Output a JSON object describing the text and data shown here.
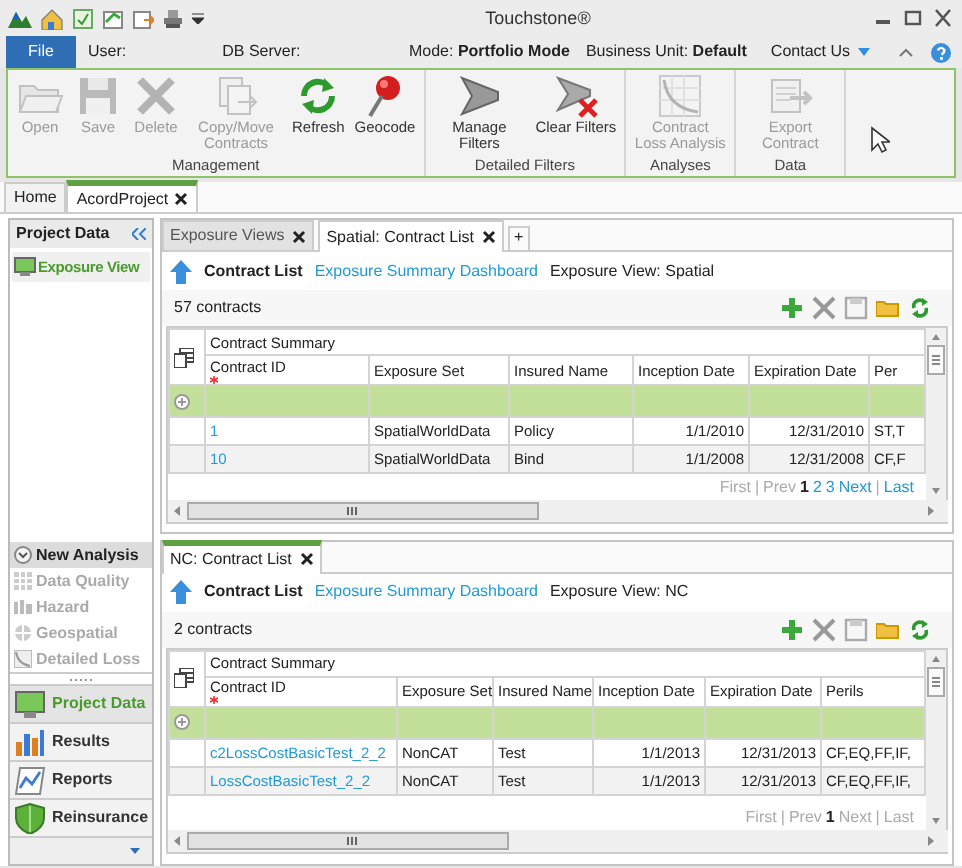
{
  "title_bar": {
    "title": "Touchstone®"
  },
  "menu_bar": {
    "file": "File",
    "user": "User:",
    "db_server": "DB Server:",
    "mode": "Mode: **Portfolio Mode**",
    "business_unit": "Business Unit: **Default**",
    "contact": "Contact Us"
  },
  "ribbon": {
    "groups": [
      {
        "label": "Management",
        "buttons": [
          {
            "label": "Open",
            "disabled": true
          },
          {
            "label": "Save",
            "disabled": true
          },
          {
            "label": "Delete",
            "disabled": true
          },
          {
            "label": "Copy/Move Contracts",
            "disabled": true
          },
          {
            "label": "Refresh",
            "disabled": false
          },
          {
            "label": "Geocode",
            "disabled": false
          }
        ]
      },
      {
        "label": "Detailed Filters",
        "buttons": [
          {
            "label": "Manage Filters",
            "disabled": false
          },
          {
            "label": "Clear Filters",
            "disabled": false
          }
        ]
      },
      {
        "label": "Analyses",
        "buttons": [
          {
            "label": "Contract Loss Analysis",
            "disabled": true
          }
        ]
      },
      {
        "label": "Data",
        "buttons": [
          {
            "label": "Export Contract",
            "disabled": true
          }
        ]
      }
    ]
  },
  "document_tabs": [
    {
      "label": "Home",
      "selected": false,
      "closable": false
    },
    {
      "label": "AcordProject",
      "selected": true,
      "closable": true
    }
  ],
  "sidebar": {
    "header": "Project Data",
    "items": [
      {
        "label": "Exposure View",
        "selected": true
      }
    ],
    "analysis": {
      "label": "New Analysis",
      "items": [
        {
          "label": "Data Quality",
          "disabled": true
        },
        {
          "label": "Hazard",
          "disabled": true
        },
        {
          "label": "Geospatial",
          "disabled": true
        },
        {
          "label": "Detailed Loss",
          "disabled": true
        }
      ]
    },
    "nav": [
      {
        "label": "Project Data",
        "selected": true
      },
      {
        "label": "Results",
        "selected": false
      },
      {
        "label": "Reports",
        "selected": false
      },
      {
        "label": "Reinsurance",
        "selected": false
      }
    ]
  },
  "panels": [
    {
      "active": false,
      "tabs": [
        {
          "label": "Exposure Views",
          "selected": false
        },
        {
          "label": "Spatial: Contract List",
          "selected": true
        }
      ],
      "add_tab": "+",
      "title": "Contract List",
      "link": "Exposure Summary Dashboard",
      "view": "Exposure View: Spatial",
      "count": "57 contracts",
      "group_header": "Contract Summary",
      "columns": [
        {
          "label": "Contract ID",
          "required": true
        },
        {
          "label": "Exposure Set",
          "required": false
        },
        {
          "label": "Insured Name",
          "required": false
        },
        {
          "label": "Inception Date",
          "required": false
        },
        {
          "label": "Expiration Date",
          "required": false
        },
        {
          "label": "Per",
          "required": false
        }
      ],
      "rows": [
        [
          "1",
          "SpatialWorldData",
          "Policy",
          "1/1/2010",
          "12/31/2010",
          "ST,T"
        ],
        [
          "10",
          "SpatialWorldData",
          "Bind",
          "1/1/2008",
          "12/31/2008",
          "CF,F"
        ]
      ],
      "pager": [
        {
          "kind": "link",
          "label": "First",
          "disabled": true
        },
        {
          "kind": "sep",
          "label": "|"
        },
        {
          "kind": "link",
          "label": "Prev",
          "disabled": true
        },
        {
          "kind": "page",
          "label": "1",
          "selected": true
        },
        {
          "kind": "page",
          "label": "2",
          "selected": false
        },
        {
          "kind": "page",
          "label": "3",
          "selected": false
        },
        {
          "kind": "link",
          "label": "Next",
          "disabled": false
        },
        {
          "kind": "sep",
          "label": "|"
        },
        {
          "kind": "link",
          "label": "Last",
          "disabled": false
        }
      ]
    },
    {
      "active": true,
      "tabs": [
        {
          "label": "NC: Contract List",
          "selected": true
        }
      ],
      "title": "Contract List",
      "link": "Exposure Summary Dashboard",
      "view": "Exposure View: NC",
      "count": "2 contracts",
      "group_header": "Contract Summary",
      "columns": [
        {
          "label": "Contract ID",
          "required": true
        },
        {
          "label": "Exposure Set",
          "required": false
        },
        {
          "label": "Insured Name",
          "required": false
        },
        {
          "label": "Inception Date",
          "required": false
        },
        {
          "label": "Expiration Date",
          "required": false
        },
        {
          "label": "Perils",
          "required": false
        }
      ],
      "rows": [
        [
          "c2LossCostBasicTest_2_2",
          "NonCAT",
          "Test",
          "1/1/2013",
          "12/31/2013",
          "CF,EQ,FF,IF,"
        ],
        [
          "LossCostBasicTest_2_2",
          "NonCAT",
          "Test",
          "1/1/2013",
          "12/31/2013",
          "CF,EQ,FF,IF,"
        ]
      ],
      "pager": [
        {
          "kind": "link",
          "label": "First",
          "disabled": true
        },
        {
          "kind": "sep",
          "label": "|"
        },
        {
          "kind": "link",
          "label": "Prev",
          "disabled": true
        },
        {
          "kind": "page",
          "label": "1",
          "selected": true
        },
        {
          "kind": "link",
          "label": "Next",
          "disabled": true
        },
        {
          "kind": "sep",
          "label": "|"
        },
        {
          "kind": "link",
          "label": "Last",
          "disabled": true
        }
      ]
    }
  ]
}
